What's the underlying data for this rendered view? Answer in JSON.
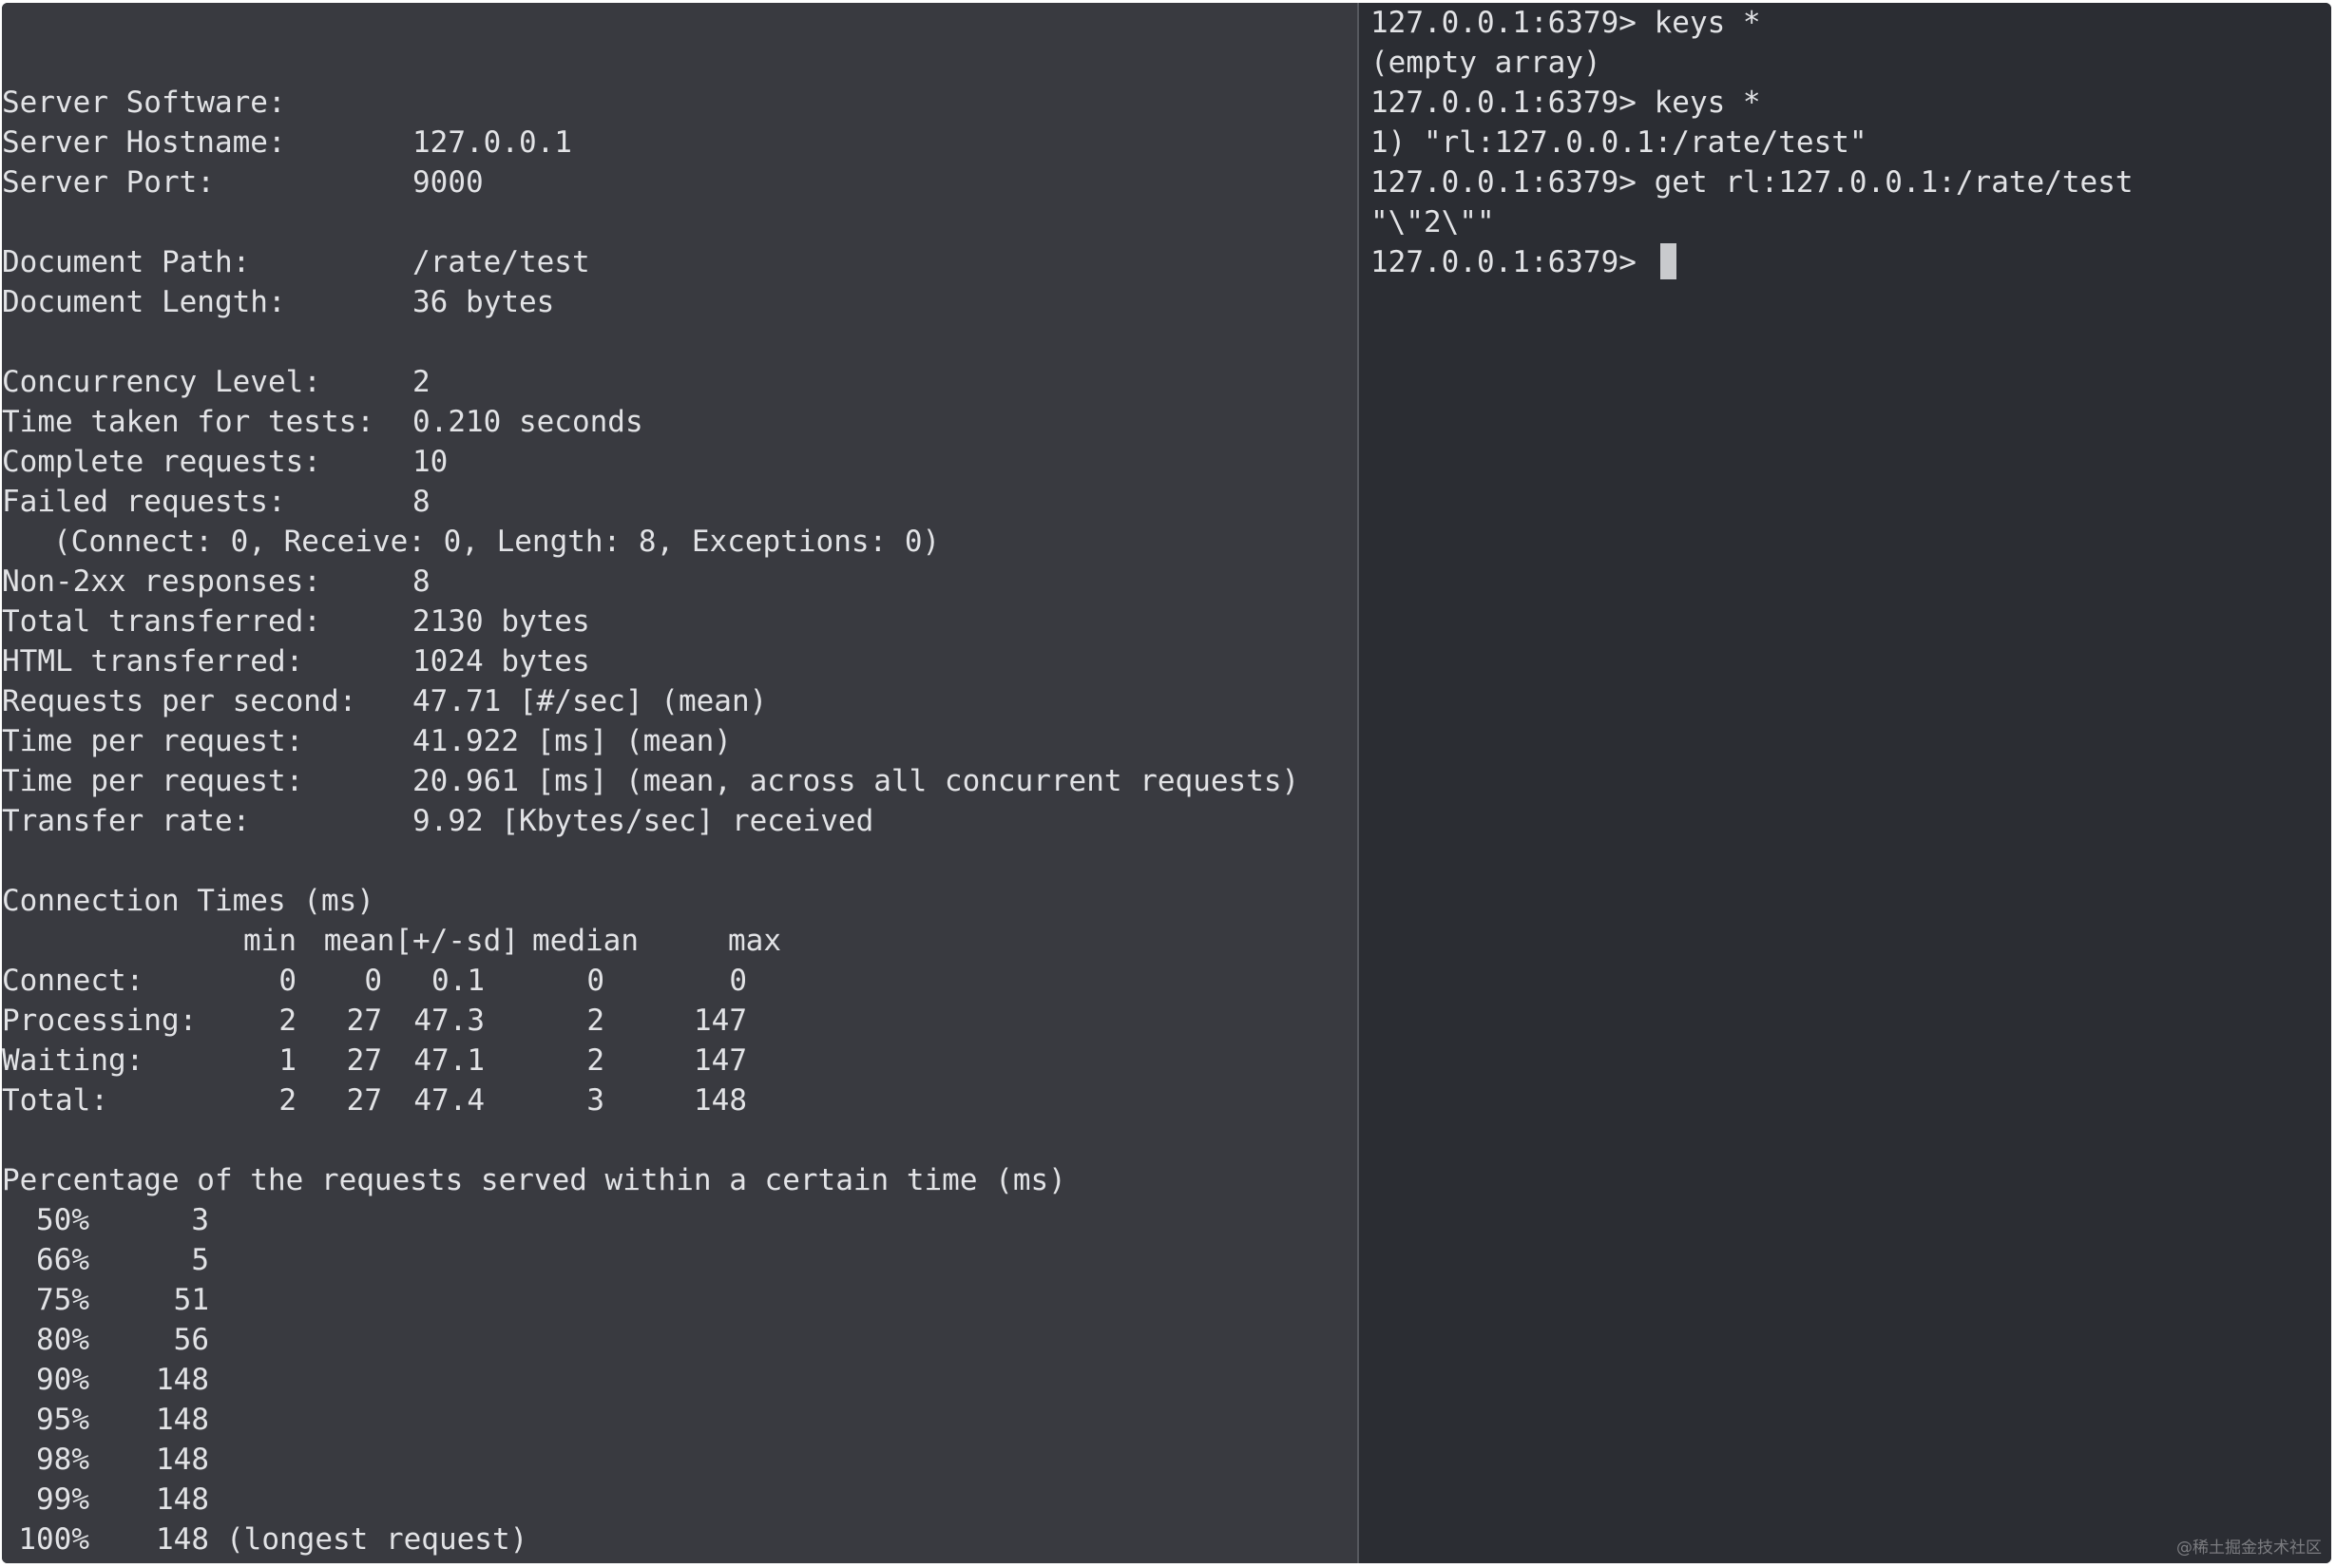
{
  "left_terminal": {
    "summary": [
      {
        "label": "Server Software:",
        "value": ""
      },
      {
        "label": "Server Hostname:",
        "value": "127.0.0.1"
      },
      {
        "label": "Server Port:",
        "value": "9000"
      },
      {
        "label": "",
        "value": ""
      },
      {
        "label": "Document Path:",
        "value": "/rate/test"
      },
      {
        "label": "Document Length:",
        "value": "36 bytes"
      },
      {
        "label": "",
        "value": ""
      },
      {
        "label": "Concurrency Level:",
        "value": "2"
      },
      {
        "label": "Time taken for tests:",
        "value": "0.210 seconds"
      },
      {
        "label": "Complete requests:",
        "value": "10"
      },
      {
        "label": "Failed requests:",
        "value": "8"
      }
    ],
    "failed_detail": "(Connect: 0, Receive: 0, Length: 8, Exceptions: 0)",
    "summary2": [
      {
        "label": "Non-2xx responses:",
        "value": "8"
      },
      {
        "label": "Total transferred:",
        "value": "2130 bytes"
      },
      {
        "label": "HTML transferred:",
        "value": "1024 bytes"
      },
      {
        "label": "Requests per second:",
        "value": "47.71 [#/sec] (mean)"
      },
      {
        "label": "Time per request:",
        "value": "41.922 [ms] (mean)"
      },
      {
        "label": "Time per request:",
        "value": "20.961 [ms] (mean, across all concurrent requests)"
      },
      {
        "label": "Transfer rate:",
        "value": "9.92 [Kbytes/sec] received"
      }
    ],
    "connection_times_title": "Connection Times (ms)",
    "connection_times_header": {
      "min": "min",
      "mean_sd": "mean[+/-sd]",
      "median": "median",
      "max": "max"
    },
    "connection_times": [
      {
        "label": "Connect:",
        "min": "0",
        "mean": "0",
        "sd": "0.1",
        "median": "0",
        "max": "0"
      },
      {
        "label": "Processing:",
        "min": "2",
        "mean": "27",
        "sd": "47.3",
        "median": "2",
        "max": "147"
      },
      {
        "label": "Waiting:",
        "min": "1",
        "mean": "27",
        "sd": "47.1",
        "median": "2",
        "max": "147"
      },
      {
        "label": "Total:",
        "min": "2",
        "mean": "27",
        "sd": "47.4",
        "median": "3",
        "max": "148"
      }
    ],
    "percentage_title": "Percentage of the requests served within a certain time (ms)",
    "percentages": [
      {
        "p": "50%",
        "v": "3",
        "note": ""
      },
      {
        "p": "66%",
        "v": "5",
        "note": ""
      },
      {
        "p": "75%",
        "v": "51",
        "note": ""
      },
      {
        "p": "80%",
        "v": "56",
        "note": ""
      },
      {
        "p": "90%",
        "v": "148",
        "note": ""
      },
      {
        "p": "95%",
        "v": "148",
        "note": ""
      },
      {
        "p": "98%",
        "v": "148",
        "note": ""
      },
      {
        "p": "99%",
        "v": "148",
        "note": ""
      },
      {
        "p": "100%",
        "v": "148",
        "note": "(longest request)"
      }
    ]
  },
  "right_terminal": {
    "lines": [
      "127.0.0.1:6379> keys *",
      "(empty array)",
      "127.0.0.1:6379> keys *",
      "1) \"rl:127.0.0.1:/rate/test\"",
      "127.0.0.1:6379> get rl:127.0.0.1:/rate/test",
      "\"\\\"2\\\"\""
    ],
    "prompt": "127.0.0.1:6379> "
  },
  "watermark": "@稀土掘金技术社区",
  "colors": {
    "left_bg": "#393a40",
    "right_bg": "#2b2d33",
    "text": "#e2e3e6",
    "cursor": "#c9cacd"
  }
}
